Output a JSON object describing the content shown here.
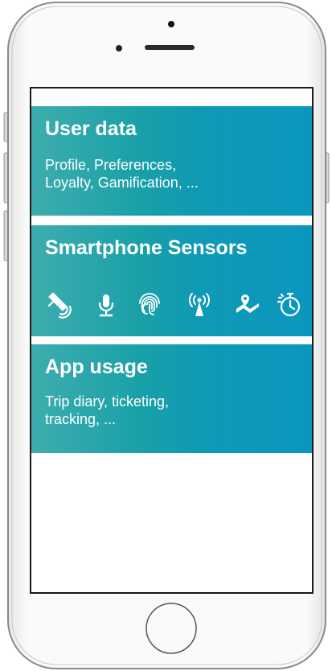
{
  "cards": {
    "user_data": {
      "title": "User data",
      "desc_line1": "Profile, Preferences,",
      "desc_line2": "Loyalty, Gamification, ..."
    },
    "sensors": {
      "title": "Smartphone Sensors",
      "icons": [
        "satellite-icon",
        "microphone-icon",
        "fingerprint-icon",
        "antenna-icon",
        "map-location-icon",
        "stopwatch-icon"
      ]
    },
    "app_usage": {
      "title": "App usage",
      "desc_line1": "Trip diary, ticketing,",
      "desc_line2": "tracking, ..."
    }
  },
  "colors": {
    "card_gradient_start": "#3dadae",
    "card_gradient_end": "#0a97bf",
    "text": "#ffffff",
    "phone_frame": "#f4f4f4",
    "screen_border": "#1a1a1a"
  }
}
